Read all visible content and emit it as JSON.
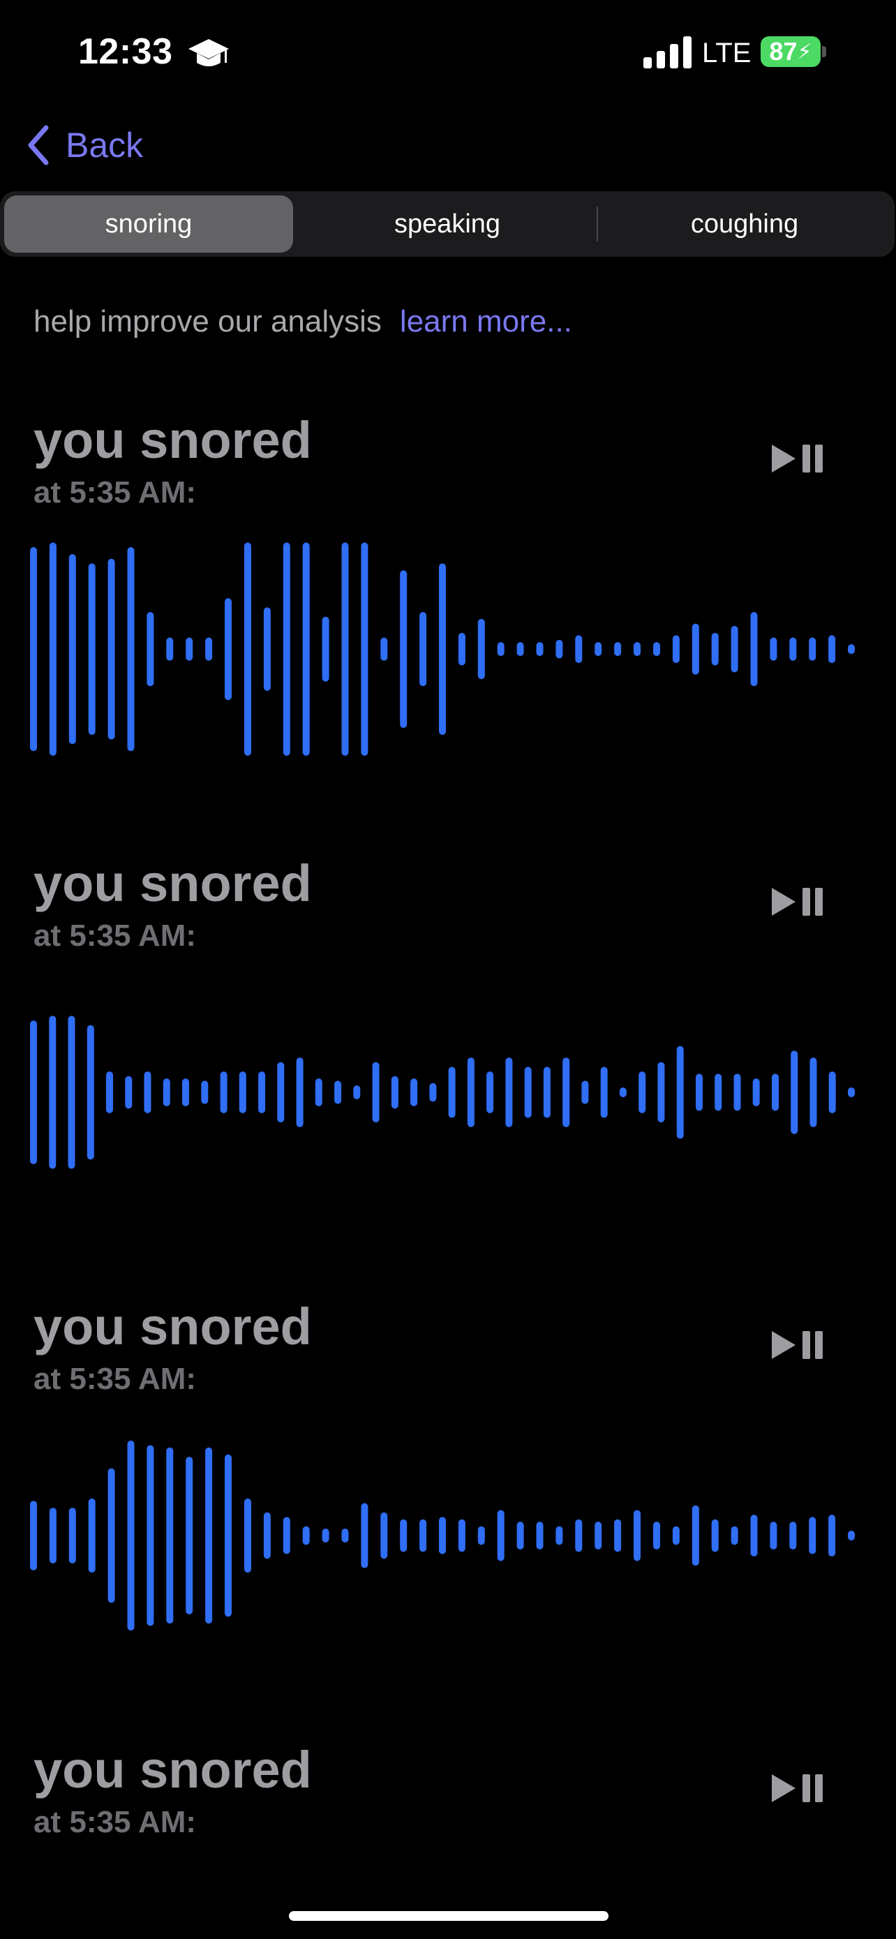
{
  "status_bar": {
    "time": "12:33",
    "network": "LTE",
    "battery": "87"
  },
  "nav": {
    "back_label": "Back"
  },
  "tabs": [
    {
      "label": "snoring",
      "active": true
    },
    {
      "label": "speaking",
      "active": false
    },
    {
      "label": "coughing",
      "active": false
    }
  ],
  "help": {
    "text": "help improve our analysis",
    "link": "learn more..."
  },
  "colors": {
    "accent": "#7a78f0",
    "waveform": "#2f6ef5",
    "battery": "#4cd964"
  },
  "recordings": [
    {
      "title": "you snored",
      "time": "at 5:35 AM:",
      "waveform": [
        0.88,
        0.92,
        0.82,
        0.74,
        0.78,
        0.88,
        0.32,
        0.1,
        0.1,
        0.1,
        0.44,
        0.92,
        0.36,
        0.92,
        0.92,
        0.28,
        0.92,
        0.92,
        0.1,
        0.68,
        0.32,
        0.74,
        0.14,
        0.26,
        0.06,
        0.06,
        0.06,
        0.08,
        0.12,
        0.06,
        0.06,
        0.06,
        0.06,
        0.12,
        0.22,
        0.14,
        0.2,
        0.32,
        0.1,
        0.1,
        0.1,
        0.12,
        0.04
      ]
    },
    {
      "title": "you snored",
      "time": "at 5:35 AM:",
      "waveform": [
        0.62,
        0.66,
        0.66,
        0.58,
        0.18,
        0.14,
        0.18,
        0.12,
        0.12,
        0.1,
        0.18,
        0.18,
        0.18,
        0.26,
        0.3,
        0.12,
        0.1,
        0.06,
        0.26,
        0.14,
        0.12,
        0.08,
        0.22,
        0.3,
        0.18,
        0.3,
        0.22,
        0.22,
        0.3,
        0.1,
        0.22,
        0.04,
        0.18,
        0.26,
        0.4,
        0.16,
        0.16,
        0.16,
        0.12,
        0.16,
        0.36,
        0.3,
        0.18,
        0.04
      ]
    },
    {
      "title": "you snored",
      "time": "at 5:35 AM:",
      "waveform": [
        0.3,
        0.24,
        0.24,
        0.32,
        0.58,
        0.82,
        0.78,
        0.76,
        0.68,
        0.76,
        0.7,
        0.32,
        0.2,
        0.16,
        0.08,
        0.06,
        0.06,
        0.28,
        0.2,
        0.14,
        0.14,
        0.16,
        0.14,
        0.08,
        0.22,
        0.12,
        0.12,
        0.08,
        0.14,
        0.12,
        0.14,
        0.22,
        0.12,
        0.08,
        0.26,
        0.14,
        0.08,
        0.18,
        0.12,
        0.12,
        0.16,
        0.18,
        0.04
      ]
    },
    {
      "title": "you snored",
      "time": "at 5:35 AM:"
    }
  ]
}
